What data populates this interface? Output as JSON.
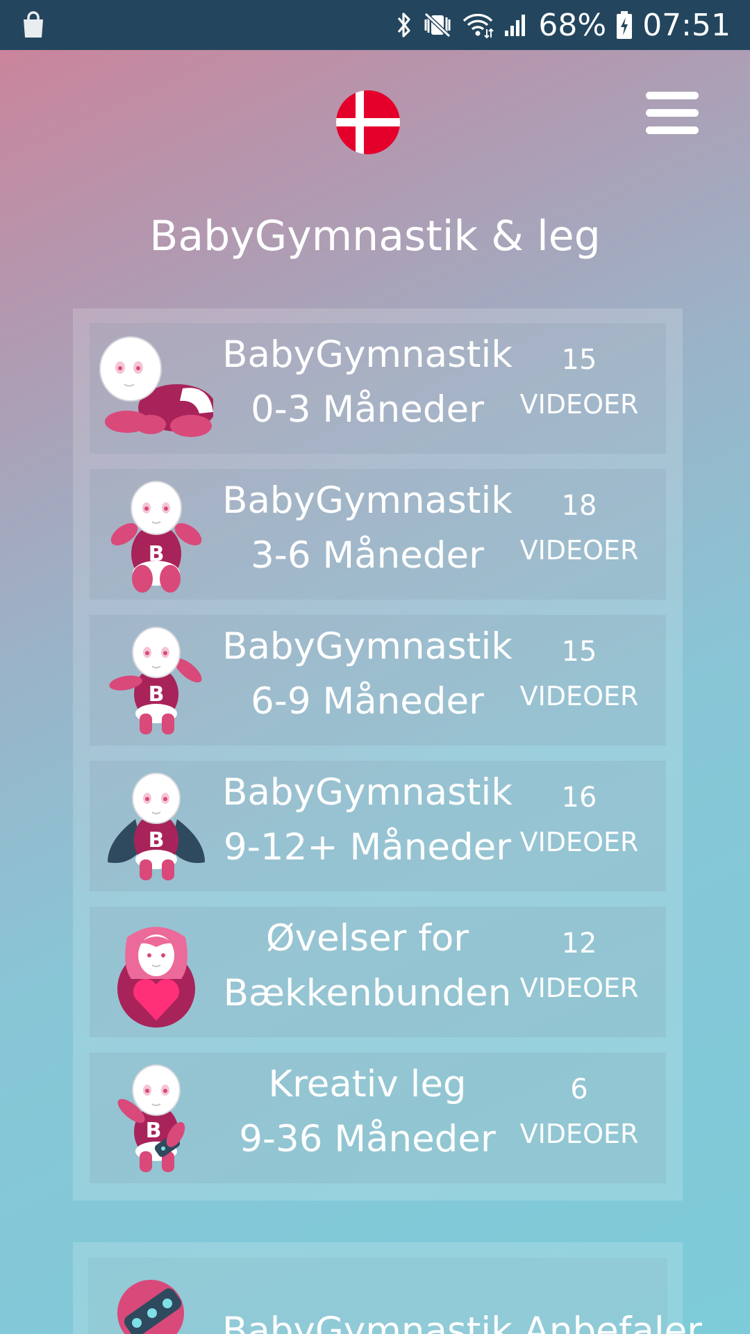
{
  "status_bar": {
    "battery": "68%",
    "time": "07:51"
  },
  "header": {
    "title": "BabyGymnastik & leg"
  },
  "courses": [
    {
      "line1": "BabyGymnastik",
      "line2": "0-3 Måneder",
      "count": "15",
      "unit": "VIDEOER",
      "icon": "crawling-baby-icon"
    },
    {
      "line1": "BabyGymnastik",
      "line2": "3-6 Måneder",
      "count": "18",
      "unit": "VIDEOER",
      "icon": "sitting-baby-icon"
    },
    {
      "line1": "BabyGymnastik",
      "line2": "6-9 Måneder",
      "count": "15",
      "unit": "VIDEOER",
      "icon": "standing-baby-icon"
    },
    {
      "line1": "BabyGymnastik",
      "line2": "9-12+ Måneder",
      "count": "16",
      "unit": "VIDEOER",
      "icon": "caped-baby-icon"
    },
    {
      "line1": "Øvelser for",
      "line2": "Bækkenbunden",
      "count": "12",
      "unit": "VIDEOER",
      "icon": "mother-heart-icon"
    },
    {
      "line1": "Kreativ leg",
      "line2": "9-36 Måneder",
      "count": "6",
      "unit": "VIDEOER",
      "icon": "playing-baby-icon"
    }
  ],
  "recommend": {
    "label": "BabyGymnastik Anbefaler",
    "icon": "toy-icon"
  },
  "colors": {
    "status_bar": "#23465e",
    "gradient_top": "#cf8198",
    "gradient_bottom": "#7dcbd9",
    "brand_pink": "#d9497a",
    "brand_magenta": "#a8235a",
    "flag_red": "#e4002b"
  }
}
